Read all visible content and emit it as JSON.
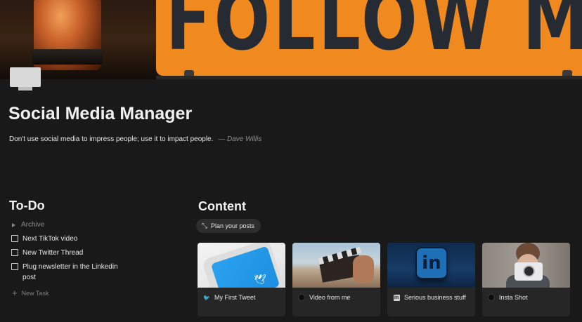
{
  "cover": {
    "sign_text": "FOLLOW ME"
  },
  "page": {
    "icon": "computer-monitor-icon",
    "title": "Social Media Manager",
    "quote": "Don't use social media to impress people; use it to impact people.",
    "quote_author": "— Dave Willis"
  },
  "todo": {
    "heading": "To-Do",
    "archive_label": "Archive",
    "items": [
      {
        "label": "Next TikTok video",
        "checked": false
      },
      {
        "label": "New Twitter Thread",
        "checked": false
      },
      {
        "label": "Plug newsletter in the Linkedin post",
        "checked": false
      }
    ],
    "new_task_label": "New Task"
  },
  "content": {
    "heading": "Content",
    "plan_button_label": "Plan your posts",
    "cards": [
      {
        "title": "My First Tweet",
        "icon": "twitter-icon"
      },
      {
        "title": "Video from me",
        "icon": "circle-icon"
      },
      {
        "title": "Serious business stuff",
        "icon": "linkedin-icon"
      },
      {
        "title": "Insta Shot",
        "icon": "circle-icon"
      }
    ]
  },
  "colors": {
    "background": "#191919",
    "card": "#262626",
    "sign_orange": "#f08a1e"
  }
}
